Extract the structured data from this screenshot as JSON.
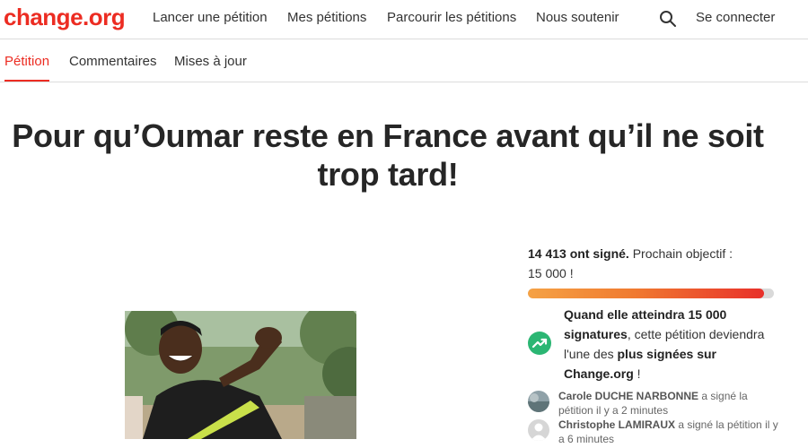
{
  "header": {
    "logo": "change.org",
    "nav": {
      "lancer": "Lancer une pétition",
      "mes": "Mes pétitions",
      "parcourir": "Parcourir les pétitions",
      "soutenir": "Nous soutenir",
      "login": "Se connecter"
    },
    "search_icon": "search-icon"
  },
  "tabs": {
    "petition": "Pétition",
    "commentaires": "Commentaires",
    "mises": "Mises à jour"
  },
  "petition": {
    "title_line1": "Pour qu’Oumar reste en France avant qu’il ne soit",
    "title_line2": "trop tard!"
  },
  "signatures": {
    "count_text": "14 413 ont signé.",
    "next_goal_text": "Prochain objectif :",
    "goal_value": "15 000 !",
    "progress": 0.9609,
    "goal_bold1": "Quand elle atteindra 15 000 signatures",
    "goal_plain1": ", cette pétition deviendra l'une des ",
    "goal_bold2": "plus signées sur Change.org",
    "goal_plain2": " !",
    "goal_icon": "trending-up-icon"
  },
  "signers": [
    {
      "name": "Carole DUCHE NARBONNE",
      "action": " a signé la pétition il y a 2 minutes"
    },
    {
      "name": "Christophe LAMIRAUX",
      "action": " a signé la pétition il y a 6 minutes"
    }
  ],
  "colors": {
    "brand": "#ec2c22",
    "progress_start": "#f5a245",
    "progress_end": "#e8302a",
    "goal_icon_bg": "#2bb673"
  }
}
